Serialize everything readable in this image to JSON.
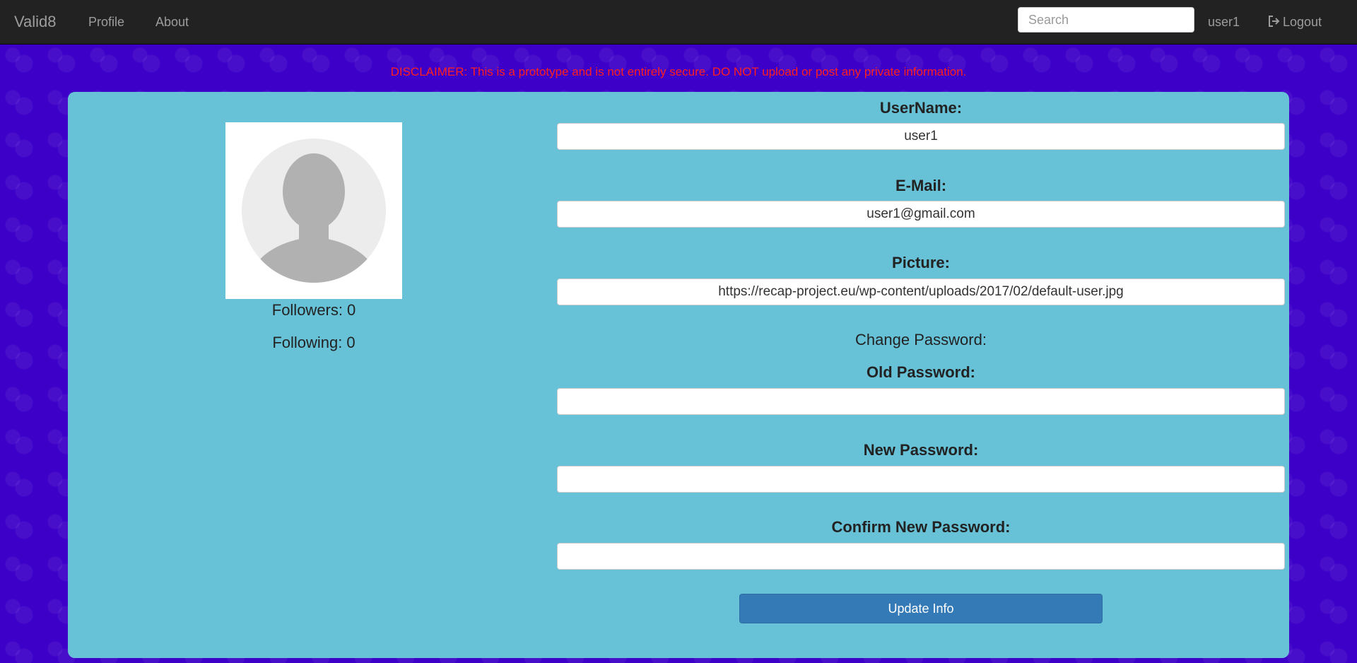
{
  "navbar": {
    "brand": "Valid8",
    "links": {
      "profile": "Profile",
      "about": "About"
    },
    "search_placeholder": "Search",
    "search_value": "",
    "user": "user1",
    "logout": "Logout",
    "logout_icon": "logout-icon"
  },
  "disclaimer": "DISCLAIMER: This is a prototype and is not entirely secure. DO NOT upload or post any private information.",
  "profile": {
    "avatar_icon": "default-user-avatar",
    "followers_label": "Followers:",
    "followers_count": "0",
    "following_label": "Following:",
    "following_count": "0"
  },
  "form": {
    "username_label": "UserName:",
    "username_value": "user1",
    "email_label": "E-Mail:",
    "email_value": "user1@gmail.com",
    "picture_label": "Picture:",
    "picture_value": "https://recap-project.eu/wp-content/uploads/2017/02/default-user.jpg",
    "change_password_label": "Change Password:",
    "old_password_label": "Old Password:",
    "old_password_value": "",
    "new_password_label": "New Password:",
    "new_password_value": "",
    "confirm_password_label": "Confirm New Password:",
    "confirm_password_value": "",
    "submit_label": "Update Info"
  },
  "colors": {
    "navbar_bg": "#222222",
    "page_bg": "#3d00c8",
    "panel_bg": "#67c2d8",
    "disclaimer": "#ff1f1f",
    "button_bg": "#337ab7"
  }
}
